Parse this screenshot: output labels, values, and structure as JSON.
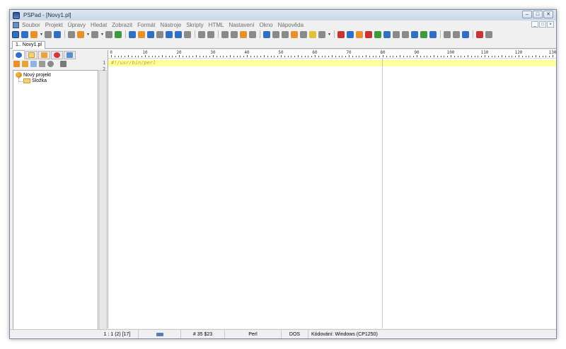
{
  "window": {
    "title": "PSPad - [Novy1.pl]"
  },
  "menu": {
    "items": [
      "Soubor",
      "Projekt",
      "Úpravy",
      "Hledat",
      "Zobrazit",
      "Formát",
      "Nástroje",
      "Skripty",
      "HTML",
      "Nastavení",
      "Okno",
      "Nápověda"
    ]
  },
  "toolbar": {
    "icons": [
      "project-icon",
      "open-project-icon",
      "new-project-icon",
      "refresh-icon",
      "html-preview-icon",
      "new-file-icon",
      "open-file-icon",
      "save-icon",
      "save-all-icon",
      "sort-icon",
      "search-icon",
      "replace-icon",
      "clipboard-icon",
      "bracket-icon",
      "book-icon",
      "print-icon",
      "print-preview-icon",
      "undo-icon",
      "redo-icon",
      "cut-icon",
      "copy-icon",
      "paste-icon",
      "delete-icon",
      "format-icon",
      "pilcrow-icon",
      "column-icon",
      "spellcheck-icon",
      "hex-icon",
      "lock-icon",
      "web-icon",
      "back-icon",
      "indent-icon",
      "box-icon",
      "color-icon",
      "chart-icon",
      "html-icon",
      "css-icon",
      "cssg-icon",
      "globe-icon",
      "magic-icon",
      "g-icon",
      "grey1-icon",
      "grey2-icon",
      "grey3-icon",
      "ftp-icon",
      "tools-icon"
    ],
    "colors": {
      "blue": "#2f6fc4",
      "orange": "#e8912b",
      "green": "#3d9a3d",
      "red": "#c83434",
      "grey": "#8a8a8a",
      "yellow": "#e4c235"
    }
  },
  "tabs": {
    "active": "1.. Novy1.pl"
  },
  "panel": {
    "project_name": "Nový projekt",
    "folder_name": "Složka"
  },
  "ruler": {
    "labels": [
      "0",
      "10",
      "20",
      "30",
      "40",
      "50",
      "60",
      "70",
      "80",
      "90",
      "100",
      "110",
      "120",
      "130"
    ]
  },
  "editor": {
    "line_numbers": [
      "1",
      "2"
    ],
    "code_line_1": "#!/usr/bin/perl",
    "code_color": "#c0a22e",
    "highlight_color": "#ffff99",
    "right_margin_column": "80"
  },
  "status": {
    "position": "1 : 1  (2)  [17]",
    "char_code": "#  35  $23",
    "highlighter": "Perl",
    "line_ending": "DOS",
    "encoding": "Kódování: Windows (CP1250)"
  }
}
